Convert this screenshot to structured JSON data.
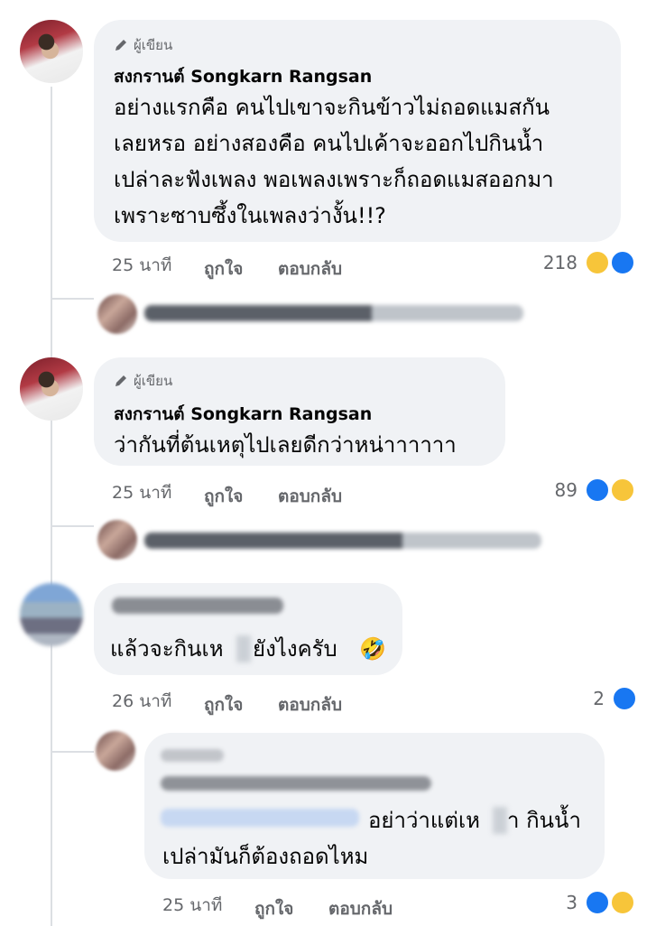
{
  "comments": [
    {
      "author_tag": "ผู้เขียน",
      "name": "สงกรานต์ Songkarn Rangsan",
      "lines": [
        "อย่างแรกคือ คนไปเขาจะกินข้าวไม่ถอดแมสกัน",
        "เลยหรอ อย่างสองคือ คนไปเค้าจะออกไปกินน้ำ",
        "เปล่าละฟังเพลง พอเพลงเพราะก็ถอดแมสออกมา",
        "เพราะซาบซึ้งในเพลงว่างั้น!!?"
      ],
      "time": "25 นาที",
      "like": "ถูกใจ",
      "reply": "ตอบกลับ",
      "reaction_count": "218",
      "reactions": [
        "haha-icon",
        "like-icon"
      ]
    },
    {
      "author_tag": "ผู้เขียน",
      "name": "สงกรานต์ Songkarn Rangsan",
      "lines": [
        "ว่ากันที่ต้นเหตุไปเลยดีกว่าหน่าาาาาา"
      ],
      "time": "25 นาที",
      "like": "ถูกใจ",
      "reply": "ตอบกลับ",
      "reaction_count": "89",
      "reactions": [
        "like-icon",
        "haha-icon"
      ]
    },
    {
      "lines": [
        "แล้วจะกินเห",
        "ยังไงครับ"
      ],
      "emoji": "🤣",
      "time": "26 นาที",
      "like": "ถูกใจ",
      "reply": "ตอบกลับ",
      "reaction_count": "2",
      "reactions": [
        "like-icon"
      ]
    },
    {
      "lines": [
        "อย่าว่าแต่เห",
        "า กินน้ำ",
        "เปล่ามันก็ต้องถอดไหม"
      ],
      "time": "25 นาที",
      "like": "ถูกใจ",
      "reply": "ตอบกลับ",
      "reaction_count": "3",
      "reactions": [
        "like-icon",
        "haha-icon"
      ]
    }
  ],
  "colors": {
    "like": "#1877f2",
    "haha": "#f7c53a",
    "bubble": "#f0f2f5",
    "meta": "#65676b"
  }
}
